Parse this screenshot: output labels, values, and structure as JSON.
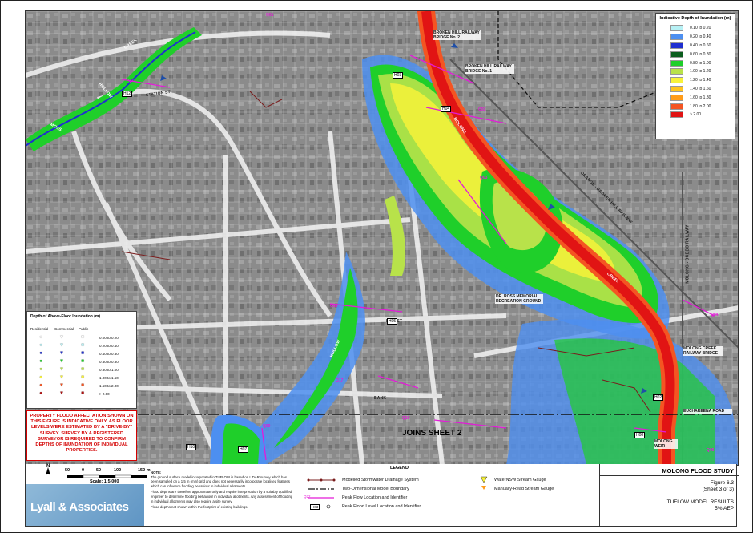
{
  "depth_legend": {
    "title": "Indicative Depth of Inundation (m)",
    "classes": [
      {
        "label": "0.10 to 0.20",
        "color": "#b7f1f5"
      },
      {
        "label": "0.20 to 0.40",
        "color": "#4d8ff0"
      },
      {
        "label": "0.40 to 0.60",
        "color": "#1f2fd0"
      },
      {
        "label": "0.60 to 0.80",
        "color": "#0b5d1e"
      },
      {
        "label": "0.80 to 1.00",
        "color": "#1fcf2a"
      },
      {
        "label": "1.00 to 1.20",
        "color": "#b8e24a"
      },
      {
        "label": "1.20 to 1.40",
        "color": "#f7f23a"
      },
      {
        "label": "1.40 to 1.60",
        "color": "#ffc51e"
      },
      {
        "label": "1.60 to 1.80",
        "color": "#ff9c1a"
      },
      {
        "label": "1.80 to 2.00",
        "color": "#f45522"
      },
      {
        "label": "> 2.00",
        "color": "#e11414"
      }
    ]
  },
  "floor_legend": {
    "title": "Depth of Above-Floor Inundation (m)",
    "headers": [
      "Residential",
      "Commercial",
      "Public"
    ],
    "rows": [
      {
        "label": "0.00 to 0.20",
        "color": "#ffffff"
      },
      {
        "label": "0.20 to 0.40",
        "color": "#b7f1f5"
      },
      {
        "label": "0.40 to 0.60",
        "color": "#1f2fd0"
      },
      {
        "label": "0.60 to 0.80",
        "color": "#1fcf2a"
      },
      {
        "label": "0.80 to 1.00",
        "color": "#b8e24a"
      },
      {
        "label": "1.00 to 1.50",
        "color": "#f7f23a"
      },
      {
        "label": "1.50 to 2.00",
        "color": "#f45522"
      },
      {
        "label": "> 2.00",
        "color": "#b01010"
      }
    ]
  },
  "warning": "PROPERTY FLOOD AFFECTATION SHOWN ON THIS FIGURE IS INDICATIVE ONLY, AS FLOOR LEVELS WERE ESTIMATED BY A \"DRIVE-BY\" SURVEY. SURVEY BY A REGISTERED SURVEYOR IS REQUIRED TO CONFIRM DEPTHS OF INUNDATION OF INDIVIDUAL PROPERTIES.",
  "joins": "JOINS SHEET 2",
  "map_labels": {
    "creek_top": "CREEK",
    "hollow_left": "HOLLOW",
    "moss": "MOSS",
    "hollow_mid": "HOLLOW",
    "molong_creek": "MOLONG",
    "creek_right": "CREEK",
    "bank_st": "BANK",
    "station_st": "STATION ST",
    "hill_st": "HILL ST",
    "bridge_top": "BROKEN HILL RAILWAY BRIDGE No. 2",
    "bridge_mid": "BROKEN HILL RAILWAY BRIDGE No. 1",
    "ross_ground": "DR. ROSS MEMORIAL RECREATION GROUND",
    "molong_bridge": "MOLONG CREEK RAILWAY BRIDGE",
    "euchareena": "EUCHAREENA ROAD",
    "molong_weir": "MOLONG WEIR",
    "rail_label": "ORANGE - BROKEN HILL RAILWAY",
    "rail_label2": "MOLONG - DUBBO RAILWAY",
    "q01": "Q01",
    "q02": "Q02",
    "q03": "Q03",
    "q04": "Q04",
    "q05": "Q05",
    "q06": "Q06",
    "q07": "Q07",
    "q08": "Q08",
    "q09": "Q09",
    "q10": "Q10",
    "q14": "Q14",
    "q17": "Q17",
    "q23": "Q23",
    "h03": "H03",
    "h05": "H05",
    "h04": "H04",
    "h12": "H12",
    "h10": "H10",
    "h02": "H02",
    "h07": "H07",
    "h08": "H08"
  },
  "scale": {
    "ticks": [
      "50",
      "0",
      "50",
      "100",
      "150 m"
    ],
    "label": "Scale: 1:5,000",
    "north": "N"
  },
  "logo": "Lyall & Associates",
  "notes": {
    "heading": "NOTE:",
    "p1": "The ground surface model incorporated in TUFLOW is based on LiDAR survey which has been sampled on a 1.5 m (min) grid and does not necessarily incorporate localised features which can influence flooding behaviour in individual allotments.",
    "p2": "Flood depths are therefore approximate only and require interpretation by a suitably qualified engineer to determine flooding behaviour in individual allotments. Any assessment of flooding in individual allotments may also require a site survey.",
    "p3": "Flood depths not shown within the footprint of existing buildings."
  },
  "legend": {
    "title": "LEGEND",
    "items": [
      "Modelled Stormwater Drainage System",
      "Two-Dimensional Model Boundary",
      "Peak Flow Location and Identifier",
      "Peak Flood Level Location and Identifier",
      "WaterNSW Stream Gauge",
      "Manually-Read Stream Gauge"
    ],
    "q_sample": "Q22",
    "h_sample": "H03"
  },
  "titleblock": {
    "study": "MOLONG FLOOD STUDY",
    "figure": "Figure 6.3",
    "sheet": "(Sheet 3 of 3)",
    "results": "TUFLOW MODEL RESULTS",
    "aep": "5% AEP"
  }
}
